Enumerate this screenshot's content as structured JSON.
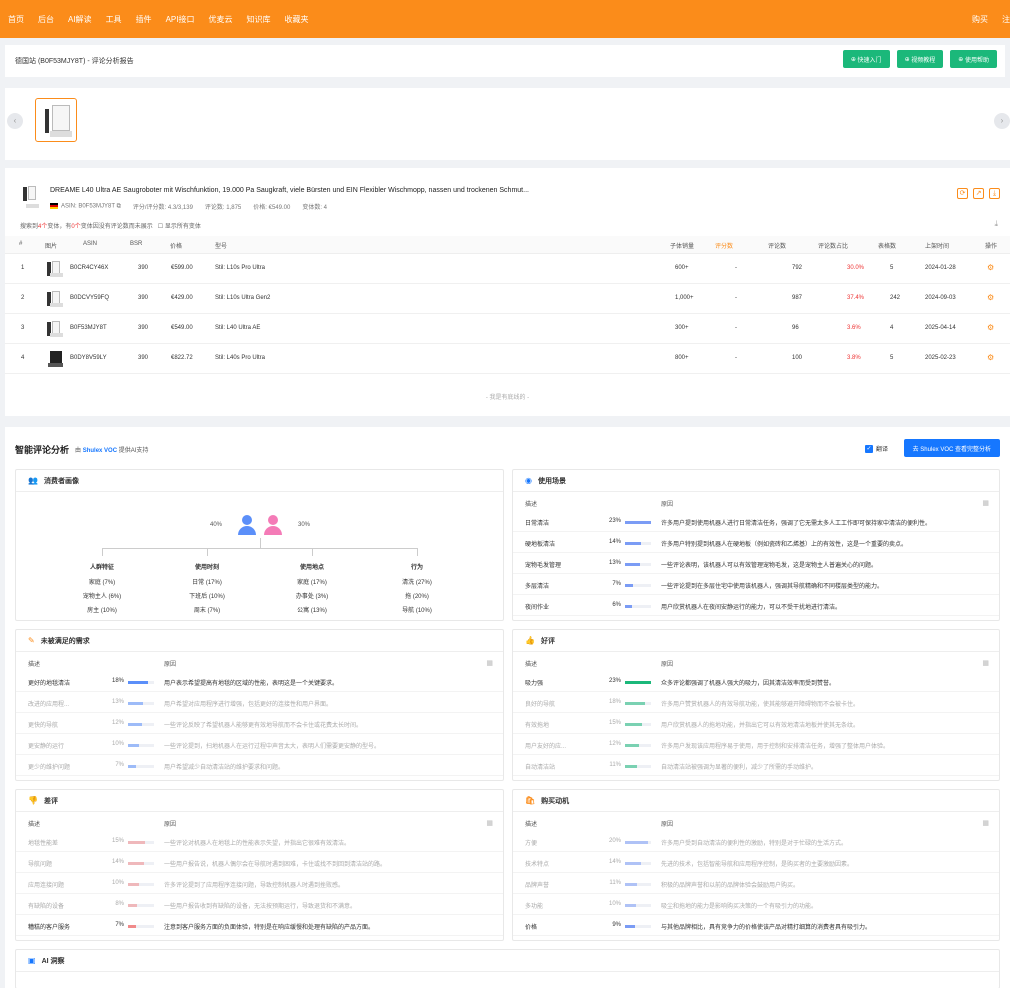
{
  "topbar": {
    "nav": [
      "首页",
      "后台",
      "AI解读",
      "工具",
      "插件",
      "API接口",
      "优麦云",
      "知识库",
      "收藏夹"
    ],
    "right": [
      "购买",
      "注"
    ]
  },
  "header": {
    "breadcrumb": "德国站 (B0F53MJY8T) - 评论分析报告",
    "buttons": [
      "快速入门",
      "视频教程",
      "使用帮助"
    ]
  },
  "product": {
    "title": "DREAME L40 Ultra AE Saugroboter mit Wischfunktion, 19.000 Pa Saugkraft, viele Bürsten und EIN Flexibler Wischmopp, nassen und trockenen Schmut...",
    "asin_label": "ASIN: B0F53MJY8T",
    "rating": "评分/评分数: 4.3/3,139",
    "reviews": "评论数: 1,875",
    "price": "价格: €549.00",
    "variants": "变体数: 4",
    "note_prefix": "搜索到",
    "note_count1": "4个",
    "note_mid": "变体，有",
    "note_count2": "0个",
    "note_suffix": "变体因没有评论数而未展示",
    "show_all": "显示所有变体"
  },
  "table": {
    "headers": [
      "#",
      "图片",
      "ASIN",
      "BSR",
      "价格",
      "型号",
      "子体销量",
      "评分数",
      "评论数",
      "评论数占比",
      "表格数",
      "上架时间",
      "操作"
    ],
    "rows": [
      {
        "n": "1",
        "asin": "B0CR4CY46X",
        "bsr": "390",
        "price": "€599.00",
        "model": "Stil: L10s Pro Ultra",
        "sales": "600+",
        "score": "-",
        "reviews": "792",
        "ratio": "30.0%",
        "table": "5",
        "date": "2024-01-28"
      },
      {
        "n": "2",
        "asin": "B0DCVY59FQ",
        "bsr": "390",
        "price": "€429.00",
        "model": "Stil: L10s Ultra Gen2",
        "sales": "1,000+",
        "score": "-",
        "reviews": "987",
        "ratio": "37.4%",
        "table": "242",
        "date": "2024-09-03"
      },
      {
        "n": "3",
        "asin": "B0F53MJY8T",
        "bsr": "390",
        "price": "€549.00",
        "model": "Stil: L40 Ultra AE",
        "sales": "300+",
        "score": "-",
        "reviews": "96",
        "ratio": "3.6%",
        "table": "4",
        "date": "2025-04-14"
      },
      {
        "n": "4",
        "asin": "B0DY8V59LY",
        "bsr": "390",
        "price": "€822.72",
        "model": "Stil: L40s Pro Ultra",
        "sales": "800+",
        "score": "-",
        "reviews": "100",
        "ratio": "3.8%",
        "table": "5",
        "date": "2025-02-23"
      }
    ],
    "no_more": "- 我是有底线的 -"
  },
  "analysis": {
    "title": "智能评论分析",
    "by_prefix": "由",
    "brand": "Shulex VOC",
    "by_suffix": "提供AI支持",
    "translate": "翻译",
    "voc_button": "去 Shulex VOC 查看完整分析",
    "col_desc": "描述",
    "col_reason": "原因",
    "persona": {
      "title": "消费者画像",
      "male_pct": "40%",
      "female_pct": "30%",
      "columns": [
        {
          "title": "人群特征",
          "items": [
            "家庭 (7%)",
            "宠物主人 (6%)",
            "房主 (10%)"
          ]
        },
        {
          "title": "使用时刻",
          "items": [
            "日常 (17%)",
            "下班后 (10%)",
            "周末 (7%)"
          ]
        },
        {
          "title": "使用地点",
          "items": [
            "家庭 (17%)",
            "办事处 (3%)",
            "公寓 (13%)"
          ]
        },
        {
          "title": "行为",
          "items": [
            "清洗 (27%)",
            "拖 (20%)",
            "导航 (10%)"
          ]
        }
      ]
    },
    "scenes": {
      "title": "使用场景",
      "rows": [
        {
          "d": "日常清洁",
          "p": "23%",
          "v": 0.23,
          "r": "许多用户提到使用机器人进行日常清洁任务，强调了它无需太多人工工作即可保持家中清洁的便利性。"
        },
        {
          "d": "硬地板清洁",
          "p": "14%",
          "v": 0.14,
          "r": "许多用户特别提到机器人在硬地板（例如瓷砖和乙烯基）上的有效性，这是一个重要的卖点。"
        },
        {
          "d": "宠物毛发管理",
          "p": "13%",
          "v": 0.13,
          "r": "一些评论表明，该机器人可以有效管理宠物毛发，这是宠物主人普遍关心的问题。"
        },
        {
          "d": "多层清洁",
          "p": "7%",
          "v": 0.07,
          "r": "一些评论提到在多层住宅中使用该机器人，强调其导航精确和不同楼层类型的能力。"
        },
        {
          "d": "夜间作业",
          "p": "6%",
          "v": 0.06,
          "r": "用户欣赏机器人在夜间安静运行的能力，可以不受干扰地进行清洁。"
        }
      ]
    },
    "unmet": {
      "title": "未被满足的需求",
      "rows": [
        {
          "d": "更好的地毯清洁",
          "p": "18%",
          "v": 0.18,
          "r": "用户表示希望提高有地毯的区域的性能，表明这是一个关键要求。"
        },
        {
          "d": "改进的应用程...",
          "p": "13%",
          "v": 0.13,
          "r": "用户希望对应用程序进行增强，包括更好的连接性和用户界面。"
        },
        {
          "d": "更快的导航",
          "p": "12%",
          "v": 0.12,
          "r": "一些评论反映了希望机器人能够更有效地导航而不会卡住或花费太长时间。"
        },
        {
          "d": "更安静的运行",
          "p": "10%",
          "v": 0.1,
          "r": "一些评论提到，扫地机器人在运行过程中声音太大，表明人们需要更安静的型号。"
        },
        {
          "d": "更少的维护问题",
          "p": "7%",
          "v": 0.07,
          "r": "用户希望减少自动清洁站的维护要求和问题。"
        }
      ]
    },
    "positive": {
      "title": "好评",
      "rows": [
        {
          "d": "吸力强",
          "p": "23%",
          "v": 0.23,
          "r": "众多评论都强调了机器人强大的吸力，因其清洁效率而受到赞誉。"
        },
        {
          "d": "良好的导航",
          "p": "18%",
          "v": 0.18,
          "r": "许多用户赞赏机器人的有效导航功能，使其能够避开障碍物而不会被卡住。"
        },
        {
          "d": "有效拖地",
          "p": "15%",
          "v": 0.15,
          "r": "用户欣赏机器人的拖地功能，并指出它可以有效地清洁地板并使其无条纹。"
        },
        {
          "d": "用户友好的应...",
          "p": "12%",
          "v": 0.12,
          "r": "许多用户发现该应用程序易于使用，用于控制和安排清洁任务，增强了整体用户体验。"
        },
        {
          "d": "自动清洁站",
          "p": "11%",
          "v": 0.11,
          "r": "自动清洁站被强调为显著的便利，减少了所需的手动维护。"
        }
      ]
    },
    "negative": {
      "title": "差评",
      "rows": [
        {
          "d": "地毯性能差",
          "p": "15%",
          "v": 0.15,
          "r": "一些评论对机器人在地毯上的性能表示失望，并指出它很难有效清洁。"
        },
        {
          "d": "导航问题",
          "p": "14%",
          "v": 0.14,
          "r": "一些用户报告说，机器人偶尔会在导航时遇到困难，卡住或找不到回到清洁站的路。"
        },
        {
          "d": "应用连接问题",
          "p": "10%",
          "v": 0.1,
          "r": "许多评论提到了应用程序连接问题，导致控制机器人时遇到挫败感。"
        },
        {
          "d": "有缺陷的设备",
          "p": "8%",
          "v": 0.08,
          "r": "一些用户报告收到有缺陷的设备，无法按预期运行，导致退货和不满意。"
        },
        {
          "d": "糟糕的客户服务",
          "p": "7%",
          "v": 0.07,
          "r": "注意到客户服务方面的负面体验，特别是在响应缓慢和处理有缺陷的产品方面。"
        }
      ]
    },
    "motive": {
      "title": "购买动机",
      "rows": [
        {
          "d": "方便",
          "p": "20%",
          "v": 0.2,
          "r": "许多用户受到自动清洁的便利性的激励，特别是对于忙碌的生活方式。"
        },
        {
          "d": "技术特点",
          "p": "14%",
          "v": 0.14,
          "r": "先进的技术，包括智能导航和应用程序控制，是购买者的主要激励因素。"
        },
        {
          "d": "品牌声誉",
          "p": "11%",
          "v": 0.11,
          "r": "积极的品牌声誉和以前的品牌体验会鼓励用户购买。"
        },
        {
          "d": "多功能",
          "p": "10%",
          "v": 0.1,
          "r": "吸尘和拖地的能力是影响购买决策的一个有吸引力的功能。"
        },
        {
          "d": "价格",
          "p": "9%",
          "v": 0.09,
          "r": "与其他品牌相比，具有竞争力的价格使该产品对精打细算的消费者具有吸引力。"
        }
      ]
    },
    "ai_insight": {
      "title": "AI 洞察"
    }
  }
}
